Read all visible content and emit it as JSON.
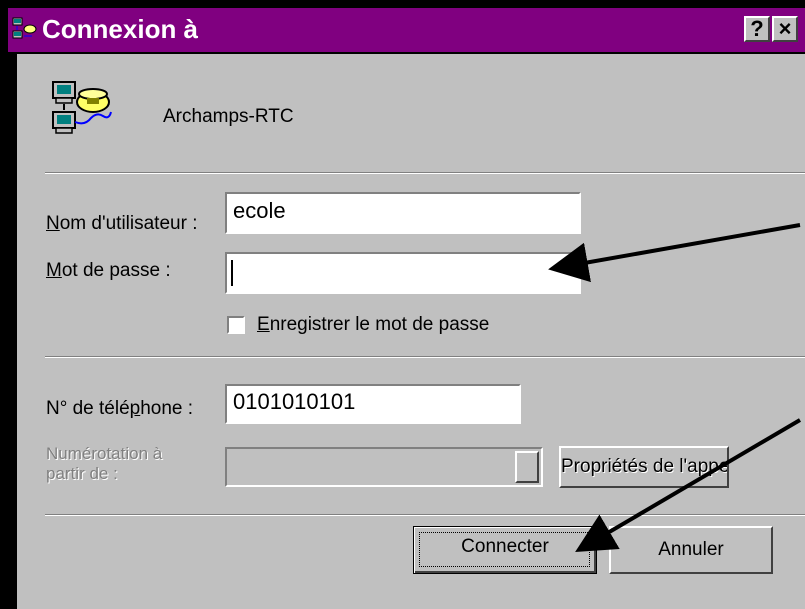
{
  "window": {
    "title": "Connexion à",
    "help_label": "?",
    "close_label": "×"
  },
  "connection": {
    "name": "Archamps-RTC"
  },
  "username": {
    "label_prefix": "",
    "label_key": "N",
    "label_rest": "om d'utilisateur :",
    "value": "ecole"
  },
  "password": {
    "label_key": "M",
    "label_rest": "ot de passe :",
    "value": ""
  },
  "save_password": {
    "label_key": "E",
    "label_rest": "nregistrer le mot de passe",
    "checked": false
  },
  "phone": {
    "label_before": "N° de télé",
    "label_key": "p",
    "label_after": "hone :",
    "value": "0101010101"
  },
  "dial_from": {
    "label_line1": "Numérotation à",
    "label_line2": "partir de :",
    "value": ""
  },
  "buttons": {
    "properties": "Propriétés de l'appel...",
    "connect": "Connecter",
    "cancel": "Annuler"
  },
  "colors": {
    "titlebar": "#800080",
    "face": "#c0c0c0"
  }
}
